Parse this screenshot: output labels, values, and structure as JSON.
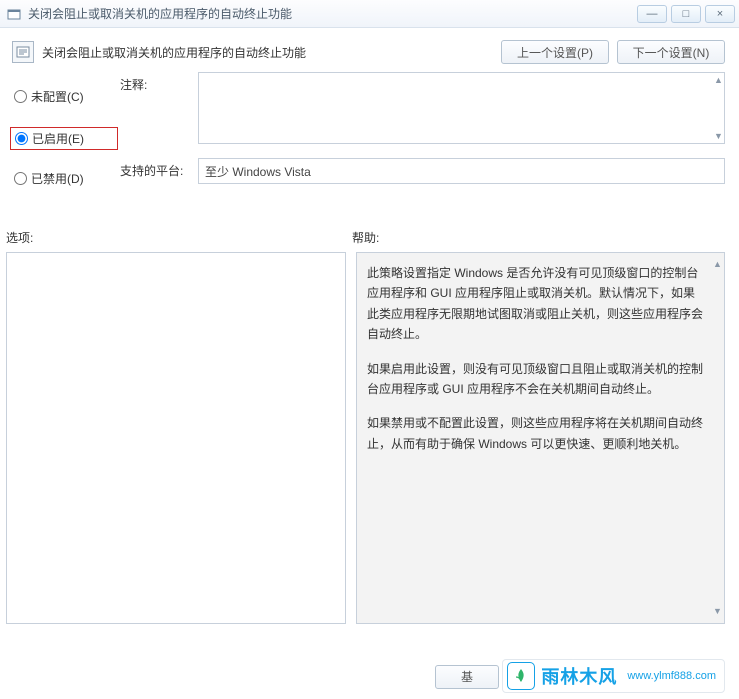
{
  "window": {
    "title": "关闭会阻止或取消关机的应用程序的自动终止功能",
    "min_glyph": "—",
    "max_glyph": "□",
    "close_glyph": "×"
  },
  "header": {
    "title": "关闭会阻止或取消关机的应用程序的自动终止功能",
    "prev_label": "上一个设置(P)",
    "next_label": "下一个设置(N)"
  },
  "radios": {
    "not_configured": "未配置(C)",
    "enabled": "已启用(E)",
    "disabled": "已禁用(D)"
  },
  "fields": {
    "comment_label": "注释:",
    "comment_value": "",
    "platform_label": "支持的平台:",
    "platform_value": "至少 Windows Vista"
  },
  "labels": {
    "options": "选项:",
    "help": "帮助:"
  },
  "help": {
    "p1": "此策略设置指定 Windows 是否允许没有可见顶级窗口的控制台应用程序和 GUI 应用程序阻止或取消关机。默认情况下，如果此类应用程序无限期地试图取消或阻止关机，则这些应用程序会自动终止。",
    "p2": "如果启用此设置，则没有可见顶级窗口且阻止或取消关机的控制台应用程序或 GUI 应用程序不会在关机期间自动终止。",
    "p3": "如果禁用或不配置此设置，则这些应用程序将在关机期间自动终止，从而有助于确保 Windows 可以更快速、更顺利地关机。"
  },
  "footer": {
    "button_stub": "基"
  },
  "watermark": {
    "brand": "雨林木风",
    "url": "www.ylmf888.com"
  }
}
